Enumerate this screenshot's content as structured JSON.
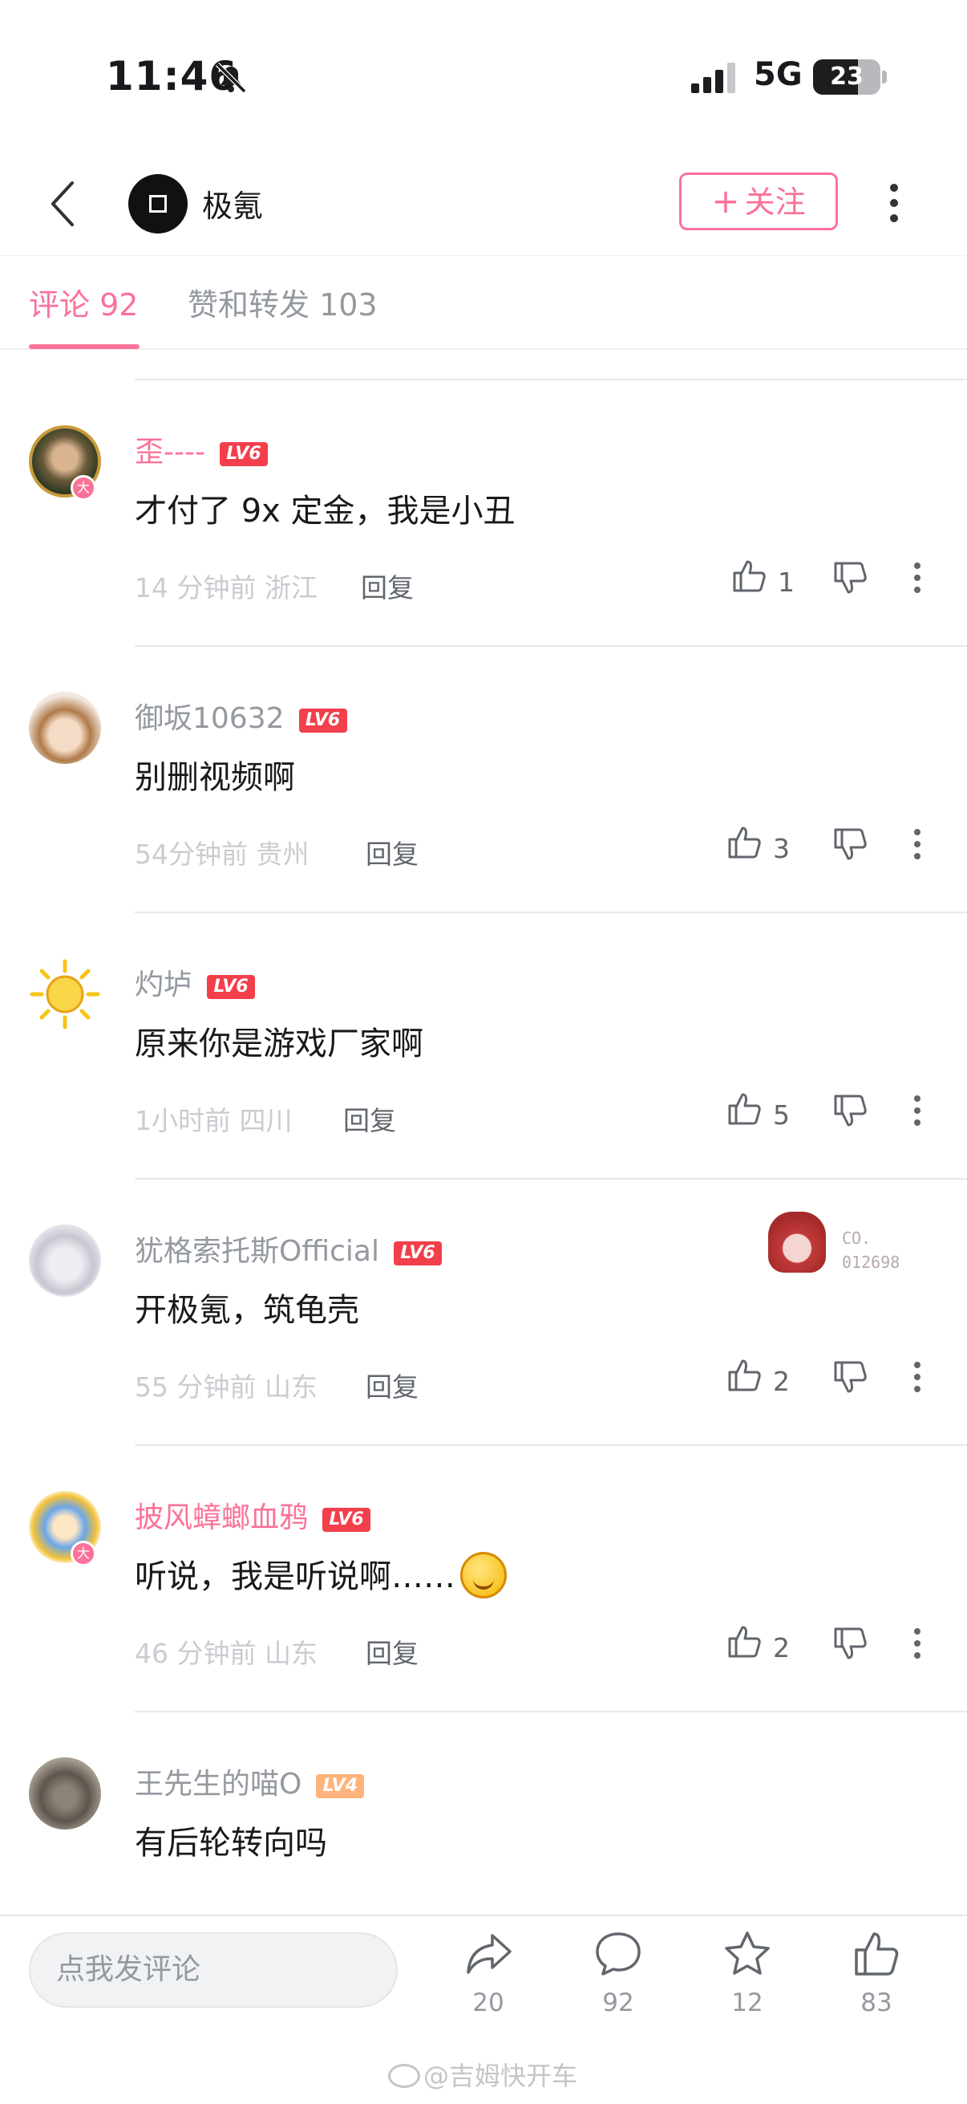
{
  "status_bar": {
    "time": "11:46",
    "network": "5G",
    "battery": "23"
  },
  "header": {
    "brand_name": "极氪",
    "follow_label": "关注"
  },
  "tabs": {
    "comments": "评论 92",
    "likes_shares": "赞和转发 103"
  },
  "comments": [
    {
      "user": "歪----",
      "level": "LV6",
      "text": "才付了 9x 定金，我是小丑",
      "time": "14 分钟前",
      "location": "浙江",
      "reply": "回复",
      "likes": "1"
    },
    {
      "user": "御坂10632",
      "level": "LV6",
      "text": "别删视频啊",
      "time": "54分钟前",
      "location": "贵州",
      "reply": "回复",
      "likes": "3"
    },
    {
      "user": "灼垆",
      "level": "LV6",
      "text": "原来你是游戏厂家啊",
      "time": "1小时前",
      "location": "四川",
      "reply": "回复",
      "likes": "5"
    },
    {
      "user": "犹格索托斯Official",
      "level": "LV6",
      "text": "开极氪，筑龟壳",
      "time": "55 分钟前",
      "location": "山东",
      "reply": "回复",
      "likes": "2",
      "fan_badge": [
        "CO.",
        "012698"
      ]
    },
    {
      "user": "披风蟑螂血鸦",
      "level": "LV6",
      "text": "听说，我是听说啊……",
      "time": "46 分钟前",
      "location": "山东",
      "reply": "回复",
      "likes": "2"
    },
    {
      "user": "王先生的喵O",
      "level": "LV4",
      "text": "有后轮转向吗"
    }
  ],
  "vip_badge": "大",
  "bottom_bar": {
    "input_placeholder": "点我发评论",
    "share_count": "20",
    "comment_count": "92",
    "favorite_count": "12",
    "like_count": "83"
  },
  "watermark": "@吉姆快开车",
  "colors": {
    "accent": "#fb7299",
    "level_red": "#f23f4b",
    "level_orange": "#ffb37c"
  }
}
